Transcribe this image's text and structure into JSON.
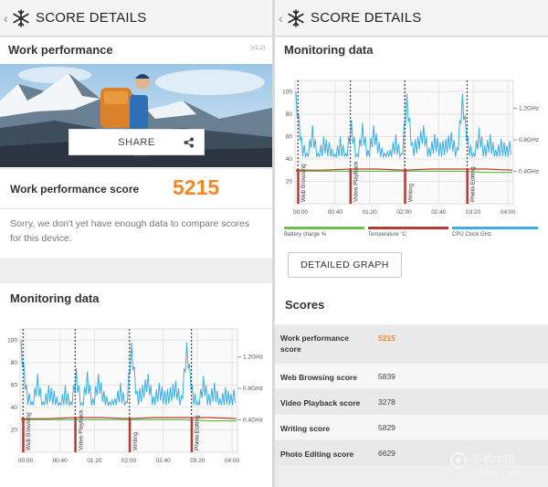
{
  "colors": {
    "accent": "#f7862a",
    "cpu": "#3aaee6",
    "battery": "#6cbf45",
    "temperature": "#b73a36"
  },
  "left": {
    "appbar": {
      "back_icon": "chevron-left-icon",
      "icon": "snowflake-icon",
      "title": "SCORE DETAILS"
    },
    "work_card": {
      "title": "Work performance",
      "version": "(v1.2)",
      "share_label": "SHARE",
      "share_icon": "share-icon",
      "score_label": "Work performance score",
      "score_value": "5215",
      "notice": "Sorry, we don't yet have enough data to compare scores for this device."
    },
    "monitoring_title": "Monitoring data"
  },
  "right": {
    "appbar": {
      "back_icon": "chevron-left-icon",
      "icon": "snowflake-icon",
      "title": "SCORE DETAILS"
    },
    "monitoring_title": "Monitoring data",
    "detailed_graph_label": "DETAILED GRAPH",
    "scores_title": "Scores",
    "scores": [
      {
        "label": "Work performance score",
        "value": "5215",
        "highlight": true
      },
      {
        "label": "Web Browsing score",
        "value": "5839"
      },
      {
        "label": "Video Playback score",
        "value": "3278"
      },
      {
        "label": "Writing score",
        "value": "5829"
      },
      {
        "label": "Photo Editing score",
        "value": "6629"
      }
    ],
    "watermark": "手机中国 CNMO.com"
  },
  "chart_data": {
    "type": "line",
    "x_ticks": [
      "00:00",
      "00:40",
      "01:20",
      "02:00",
      "02:40",
      "03:20",
      "04:00"
    ],
    "y_ticks_left": [
      20,
      40,
      60,
      80,
      100
    ],
    "y_ticks_right": [
      "0.4GHz",
      "0.8GHz",
      "1.2GHz"
    ],
    "ylim": [
      0,
      110
    ],
    "segments": [
      "Web Browsing",
      "Video Playback",
      "Writing",
      "Photo Editing"
    ],
    "legend": [
      "Battery charge %",
      "Temperature °C",
      "CPU Clock GHz"
    ],
    "grid": true,
    "series": [
      {
        "name": "Battery charge %",
        "values": [
          29,
          29,
          29,
          29,
          29,
          29,
          29,
          28,
          28
        ]
      },
      {
        "name": "Temperature °C",
        "values": [
          30,
          30,
          31,
          31,
          30,
          31,
          31,
          31,
          30
        ]
      },
      {
        "name": "CPU Clock GHz",
        "values": [
          100,
          60,
          45,
          70,
          45,
          60,
          55,
          44,
          60,
          45,
          75,
          44,
          72,
          48,
          70,
          55,
          45,
          48,
          62,
          45,
          98,
          55,
          60,
          70,
          50,
          62,
          55,
          58,
          64,
          50,
          98,
          60,
          45,
          68,
          52,
          62,
          48,
          58,
          52,
          60
        ]
      }
    ]
  }
}
